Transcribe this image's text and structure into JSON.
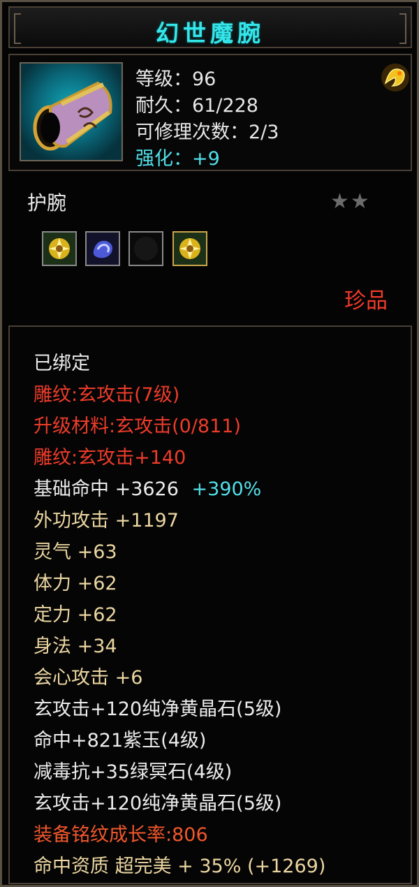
{
  "item": {
    "title": "幻世魔腕",
    "level": "等级：96",
    "durability": "耐久：61/228",
    "repair": "可修理次数：2/3",
    "enhance": "强化：+9",
    "type": "护腕",
    "stars": "★★",
    "rarity": "珍品",
    "icon": "purple-bracer-icon",
    "badge_icon": "gold-dragon-badge-icon"
  },
  "gem_slots": [
    {
      "icon": "yellow-crystal-gem-icon"
    },
    {
      "icon": "purple-jade-gem-icon"
    },
    {
      "icon": "empty-slot-icon"
    },
    {
      "icon": "yellow-crystal-gem-icon"
    }
  ],
  "attributes": {
    "bound": "已绑定",
    "engrave1": "雕纹:玄攻击(7级)",
    "upgrade_material": "升级材料:玄攻击(0/811)",
    "engrave2": "雕纹:玄攻击+140",
    "hit_label": "基础命中  +3626",
    "hit_percent": "+390%",
    "ext_attack": "外功攻击  +1197",
    "spirit": "灵气  +63",
    "stamina": "体力  +62",
    "focus": "定力  +62",
    "agility": "身法  +34",
    "crit": "会心攻击  +6",
    "gem1": "玄攻击+120纯净黄晶石(5级)",
    "gem2": "命中+821紫玉(4级)",
    "gem3": "减毒抗+35绿冥石(4级)",
    "gem4": "玄攻击+120纯净黄晶石(5级)",
    "growth": "装备铭纹成长率:806",
    "hit_quality": "命中资质  超完美  +  35%  (+1269)"
  },
  "colors": {
    "title": "#34e6ea",
    "red": "#ee3c2a",
    "gold": "#ecd7a2",
    "cyan": "#52dfe8",
    "orange": "#f2572c"
  }
}
